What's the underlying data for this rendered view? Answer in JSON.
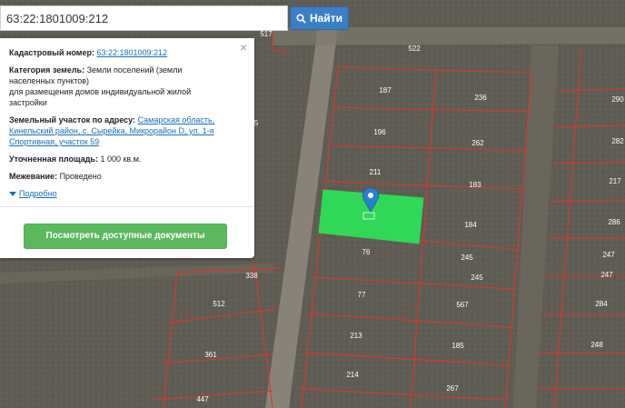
{
  "search": {
    "value": "63:22:1801009:212",
    "button_label": "Найти",
    "icon": "search-icon"
  },
  "popup": {
    "close_symbol": "×",
    "cadastral_label": "Кадастровый номер:",
    "cadastral_value": "63:22:1801009:212",
    "category_label": "Категория земель:",
    "category_value_1": "Земли поселений (земли",
    "category_value_2": "населенных пунктов)",
    "purpose_line_1": "для размещения домов индивидуальной жилой",
    "purpose_line_2": "застройки",
    "address_label": "Земельный участок по адресу:",
    "address_value_1": "Самарская область,",
    "address_value_2": "Кинельский район, с. Сырейка, Микрорайон D, ул. 1-я",
    "address_value_3": "Спортивная, участок 59",
    "area_label": "Уточненная площадь:",
    "area_value": "1 000 кв.м.",
    "survey_label": "Межевание:",
    "survey_value": "Проведено",
    "more_label": "Подробно",
    "docs_button_label": "Посмотреть доступные документы"
  },
  "map": {
    "highlight_color": "#2fd957",
    "boundary_color": "#e8302a",
    "marker_color": "#2b7fd1",
    "plot_labels": [
      "517",
      "522",
      "187",
      "236",
      "196",
      "262",
      "211",
      "183",
      "184",
      "76",
      "245",
      "245",
      "77",
      "567",
      "213",
      "185",
      "214",
      "267",
      "338",
      "512",
      "361",
      "447",
      "5",
      "290",
      "282",
      "217",
      "286",
      "247",
      "247",
      "284",
      "248"
    ]
  }
}
